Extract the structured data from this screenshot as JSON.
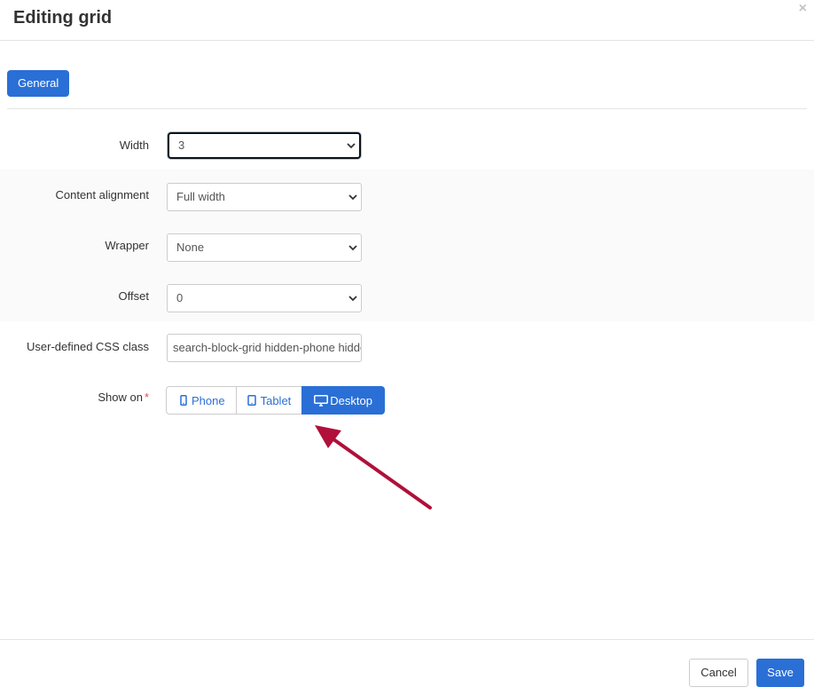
{
  "dialog": {
    "title": "Editing grid",
    "close_glyph": "×"
  },
  "tabs": [
    {
      "label": "General",
      "active": true
    }
  ],
  "form": {
    "width": {
      "label": "Width",
      "value": "3"
    },
    "content_alignment": {
      "label": "Content alignment",
      "value": "Full width"
    },
    "wrapper": {
      "label": "Wrapper",
      "value": "None"
    },
    "offset": {
      "label": "Offset",
      "value": "0"
    },
    "css_class": {
      "label": "User-defined CSS class",
      "value": "search-block-grid hidden-phone hidden-tablet"
    },
    "show_on": {
      "label": "Show on",
      "required_mark": "*",
      "options": [
        {
          "label": "Phone",
          "icon": "mobile-phone-icon",
          "active": false
        },
        {
          "label": "Tablet",
          "icon": "tablet-icon",
          "active": false
        },
        {
          "label": "Desktop",
          "icon": "desktop-monitor-icon",
          "active": true
        }
      ]
    }
  },
  "footer": {
    "cancel_label": "Cancel",
    "save_label": "Save"
  },
  "colors": {
    "primary": "#2a6fd6",
    "annotation_arrow": "#b0103a",
    "required": "#d9534f"
  }
}
